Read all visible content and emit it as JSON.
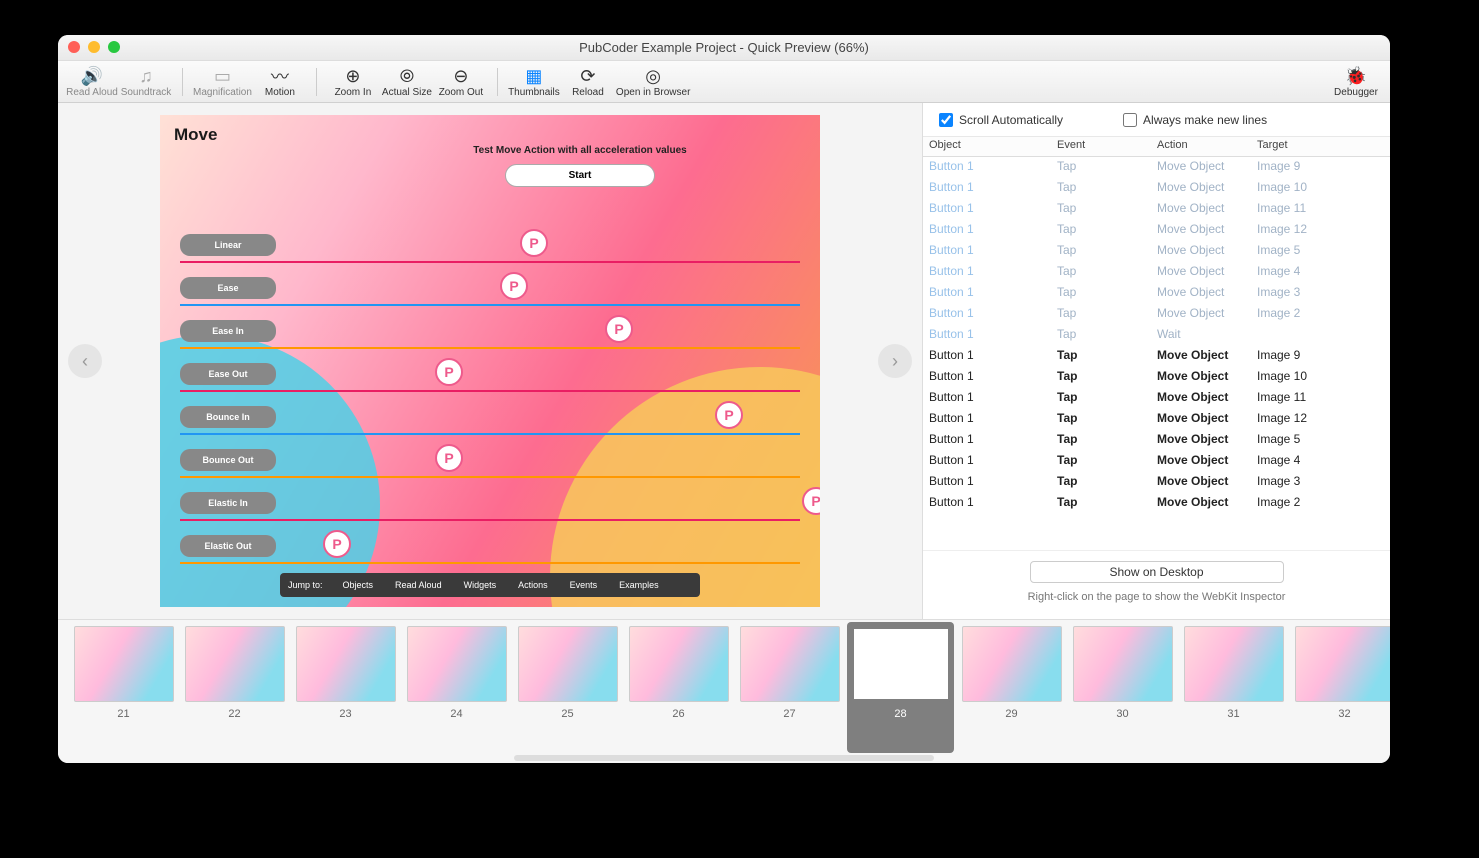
{
  "window": {
    "title": "PubCoder Example Project - Quick Preview (66%)"
  },
  "toolbar": {
    "readAloud": "Read Aloud",
    "soundtrack": "Soundtrack",
    "magnification": "Magnification",
    "motion": "Motion",
    "zoomIn": "Zoom In",
    "actualSize": "Actual Size",
    "zoomOut": "Zoom Out",
    "thumbnails": "Thumbnails",
    "reload": "Reload",
    "openInBrowser": "Open in Browser",
    "debugger": "Debugger"
  },
  "preview": {
    "title": "Move",
    "subtitle": "Test Move Action with all acceleration values",
    "startButton": "Start",
    "easings": [
      "Linear",
      "Ease",
      "Ease In",
      "Ease Out",
      "Bounce In",
      "Bounce Out",
      "Elastic In",
      "Elastic Out"
    ],
    "lineColors": [
      "#e91e63",
      "#2196f3",
      "#ff9800",
      "#e91e63",
      "#2196f3",
      "#ff9800",
      "#e91e63",
      "#ff9800"
    ],
    "ballX": [
      340,
      320,
      425,
      255,
      535,
      255,
      622,
      143
    ],
    "nav": {
      "jumpTo": "Jump to:",
      "items": [
        "Objects",
        "Read Aloud",
        "Widgets",
        "Actions",
        "Events",
        "Examples"
      ]
    }
  },
  "debug": {
    "scrollAuto": "Scroll Automatically",
    "alwaysNew": "Always make new lines",
    "headers": {
      "object": "Object",
      "event": "Event",
      "action": "Action",
      "target": "Target"
    },
    "rows": [
      {
        "o": "Button 1",
        "e": "Tap",
        "a": "Move Object",
        "t": "Image 9",
        "f": true
      },
      {
        "o": "Button 1",
        "e": "Tap",
        "a": "Move Object",
        "t": "Image 10",
        "f": true
      },
      {
        "o": "Button 1",
        "e": "Tap",
        "a": "Move Object",
        "t": "Image 11",
        "f": true
      },
      {
        "o": "Button 1",
        "e": "Tap",
        "a": "Move Object",
        "t": "Image 12",
        "f": true
      },
      {
        "o": "Button 1",
        "e": "Tap",
        "a": "Move Object",
        "t": "Image 5",
        "f": true
      },
      {
        "o": "Button 1",
        "e": "Tap",
        "a": "Move Object",
        "t": "Image 4",
        "f": true
      },
      {
        "o": "Button 1",
        "e": "Tap",
        "a": "Move Object",
        "t": "Image 3",
        "f": true
      },
      {
        "o": "Button 1",
        "e": "Tap",
        "a": "Move Object",
        "t": "Image 2",
        "f": true
      },
      {
        "o": "Button 1",
        "e": "Tap",
        "a": "Wait",
        "t": "",
        "f": true
      },
      {
        "o": "Button 1",
        "e": "Tap",
        "a": "Move Object",
        "t": "Image 9",
        "f": false
      },
      {
        "o": "Button 1",
        "e": "Tap",
        "a": "Move Object",
        "t": "Image 10",
        "f": false
      },
      {
        "o": "Button 1",
        "e": "Tap",
        "a": "Move Object",
        "t": "Image 11",
        "f": false
      },
      {
        "o": "Button 1",
        "e": "Tap",
        "a": "Move Object",
        "t": "Image 12",
        "f": false
      },
      {
        "o": "Button 1",
        "e": "Tap",
        "a": "Move Object",
        "t": "Image 5",
        "f": false
      },
      {
        "o": "Button 1",
        "e": "Tap",
        "a": "Move Object",
        "t": "Image 4",
        "f": false
      },
      {
        "o": "Button 1",
        "e": "Tap",
        "a": "Move Object",
        "t": "Image 3",
        "f": false
      },
      {
        "o": "Button 1",
        "e": "Tap",
        "a": "Move Object",
        "t": "Image 2",
        "f": false
      }
    ],
    "showOnDesktop": "Show on Desktop",
    "hint": "Right-click on the page to show the WebKit Inspector"
  },
  "thumbs": {
    "pages": [
      21,
      22,
      23,
      24,
      25,
      26,
      27,
      28,
      29,
      30,
      31,
      32
    ],
    "selected": 28
  }
}
